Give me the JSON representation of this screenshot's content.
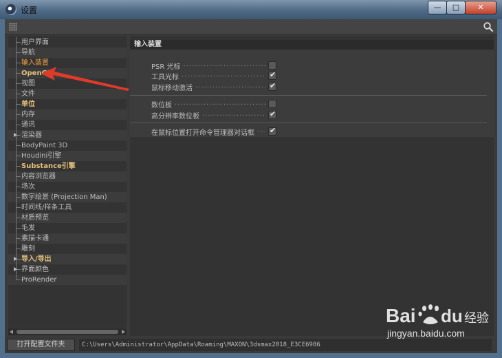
{
  "window": {
    "title": "设置"
  },
  "tree": {
    "items": [
      {
        "label": "用户界面",
        "style": "normal",
        "arrow": false
      },
      {
        "label": "导航",
        "style": "normal",
        "arrow": false
      },
      {
        "label": "输入装置",
        "style": "selected",
        "arrow": false
      },
      {
        "label": "OpenGL",
        "style": "highlight",
        "arrow": false
      },
      {
        "label": "视图",
        "style": "normal",
        "arrow": false
      },
      {
        "label": "文件",
        "style": "normal",
        "arrow": false
      },
      {
        "label": "单位",
        "style": "highlight",
        "arrow": false
      },
      {
        "label": "内存",
        "style": "normal",
        "arrow": false
      },
      {
        "label": "通讯",
        "style": "normal",
        "arrow": false
      },
      {
        "label": "渲染器",
        "style": "normal",
        "arrow": true
      },
      {
        "label": "BodyPaint 3D",
        "style": "normal",
        "arrow": false
      },
      {
        "label": "Houdini引擎",
        "style": "normal",
        "arrow": false
      },
      {
        "label": "Substance引擎",
        "style": "highlight",
        "arrow": false
      },
      {
        "label": "内容浏览器",
        "style": "normal",
        "arrow": false
      },
      {
        "label": "场次",
        "style": "normal",
        "arrow": false
      },
      {
        "label": "数字绘景 (Projection Man)",
        "style": "normal",
        "arrow": false
      },
      {
        "label": "时间线/样条工具",
        "style": "normal",
        "arrow": false
      },
      {
        "label": "材质预览",
        "style": "normal",
        "arrow": false
      },
      {
        "label": "毛发",
        "style": "normal",
        "arrow": false
      },
      {
        "label": "素描卡通",
        "style": "normal",
        "arrow": false
      },
      {
        "label": "雕刻",
        "style": "normal",
        "arrow": false
      },
      {
        "label": "导入/导出",
        "style": "highlight",
        "arrow": true
      },
      {
        "label": "界面颜色",
        "style": "normal",
        "arrow": true
      },
      {
        "label": "ProRender",
        "style": "normal",
        "arrow": false
      }
    ]
  },
  "content": {
    "section_title": "输入装置",
    "options": [
      {
        "label": "PSR 光标",
        "checked": false
      },
      {
        "label": "工具光标",
        "checked": true
      },
      {
        "label": "鼠标移动激活",
        "checked": true
      },
      {
        "label": "数位板",
        "checked": false
      },
      {
        "label": "高分辨率数位板",
        "checked": true
      },
      {
        "label": "在鼠标位置打开命令管理器对话框",
        "checked": true
      }
    ]
  },
  "bottom": {
    "open_folder_label": "打开配置文件夹",
    "path": "C:\\Users\\Administrator\\AppData\\Roaming\\MAXON\\3dsmax2018_E3CE6986"
  },
  "watermark": {
    "text": "jingyan.baidu.com"
  },
  "colors": {
    "highlight": "#e5c07b",
    "selected": "#f0a040",
    "annotation_arrow": "#e03a2a"
  }
}
